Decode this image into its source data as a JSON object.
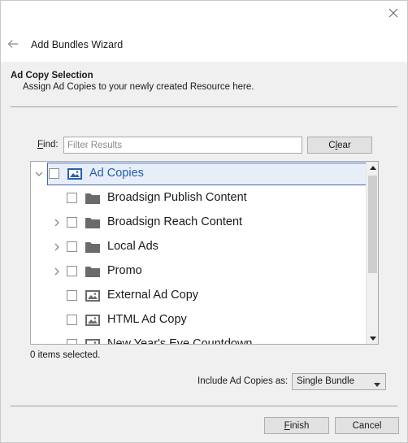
{
  "wizard": {
    "title": "Add Bundles Wizard",
    "close_icon": "close-icon",
    "back_icon": "back-arrow-icon"
  },
  "section": {
    "title": "Ad Copy Selection",
    "subtitle": "Assign Ad Copies to your newly created Resource here."
  },
  "find": {
    "label_prefix": "F",
    "label_rest": "ind:",
    "placeholder": "Filter Results",
    "value": "",
    "clear_prefix": "C",
    "clear_mid": "l",
    "clear_rest": "ear"
  },
  "tree": {
    "items": [
      {
        "label": "Ad Copies",
        "icon": "ad-copies-icon",
        "expandable": true,
        "expanded": true,
        "selected": true,
        "level": 0
      },
      {
        "label": "Broadsign Publish Content",
        "icon": "folder-icon",
        "expandable": false,
        "level": 1
      },
      {
        "label": "Broadsign Reach Content",
        "icon": "folder-icon",
        "expandable": true,
        "level": 1
      },
      {
        "label": "Local Ads",
        "icon": "folder-icon",
        "expandable": true,
        "level": 1
      },
      {
        "label": "Promo",
        "icon": "folder-icon",
        "expandable": true,
        "level": 1
      },
      {
        "label": "External Ad Copy",
        "icon": "image-icon",
        "expandable": false,
        "level": 1
      },
      {
        "label": "HTML Ad Copy",
        "icon": "image-icon",
        "expandable": false,
        "level": 1
      },
      {
        "label": "New Year's Eve Countdown",
        "icon": "image-icon",
        "expandable": false,
        "level": 1
      }
    ]
  },
  "status": {
    "selected_text": "0 items selected."
  },
  "include": {
    "label": "Include Ad Copies as:",
    "selected": "Single Bundle"
  },
  "footer": {
    "finish_prefix": "F",
    "finish_rest": "inish",
    "cancel_label": "Cancel"
  },
  "colors": {
    "accent": "#1f5fb0",
    "selection_border": "#3c6bb5"
  }
}
